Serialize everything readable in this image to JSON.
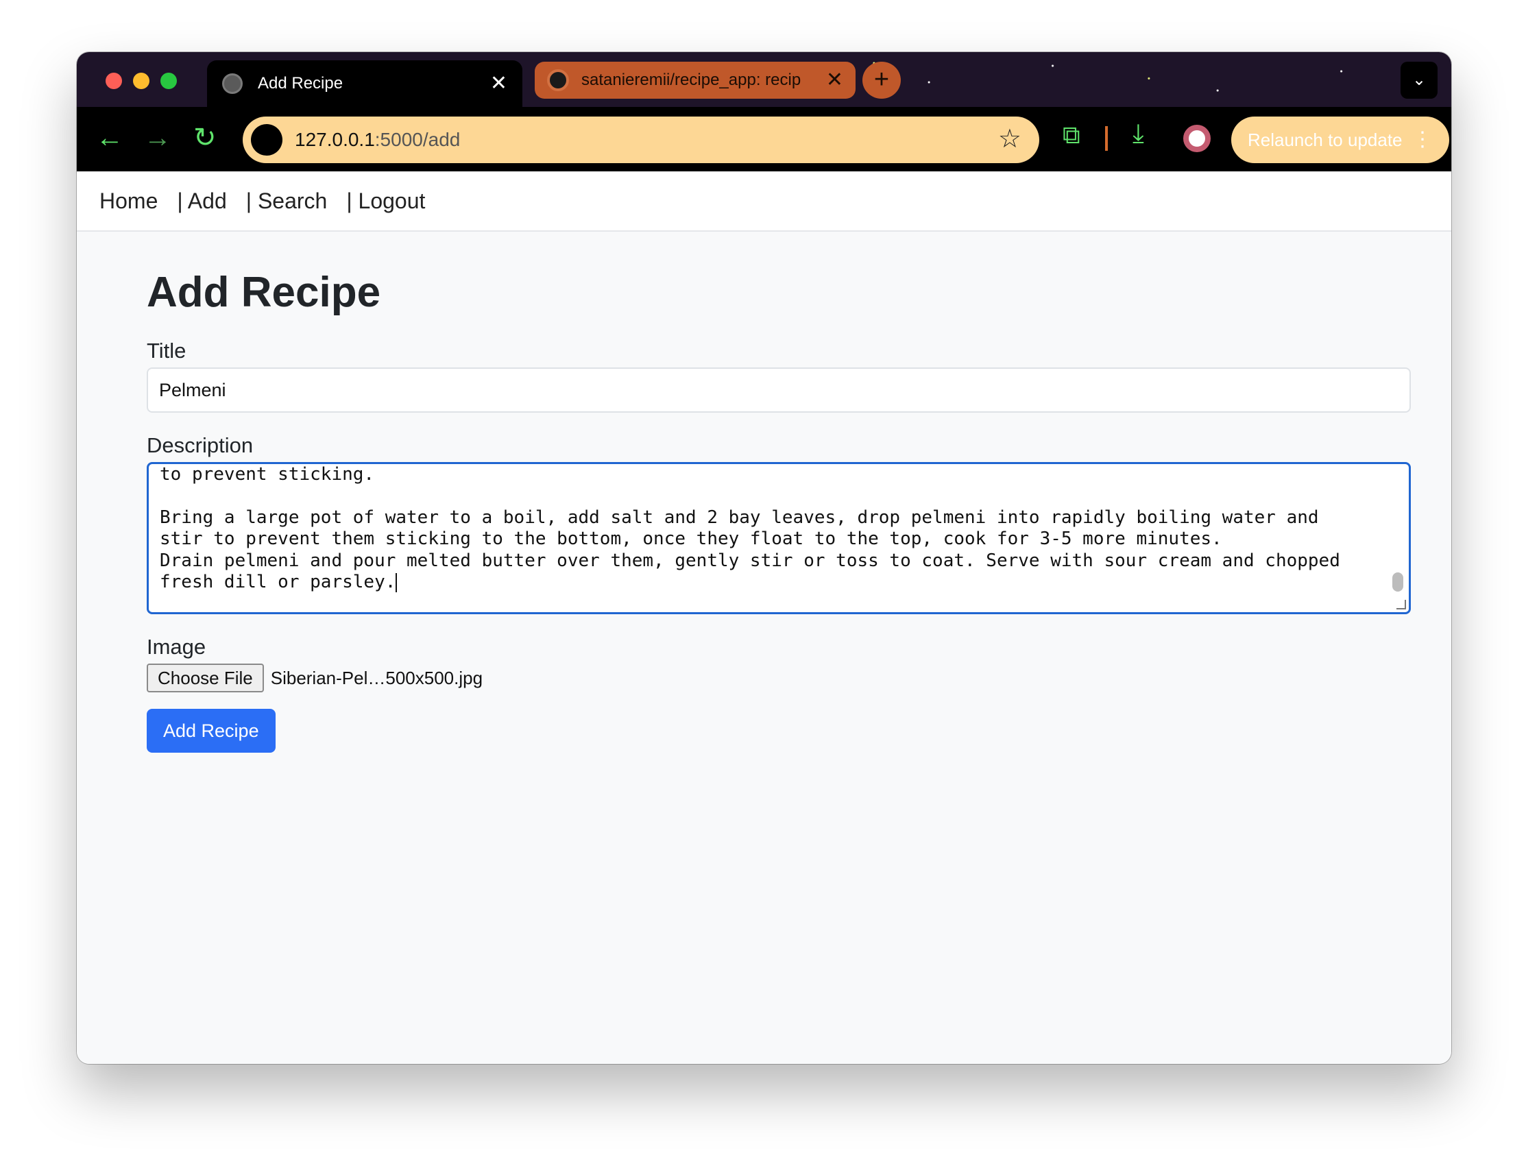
{
  "browser": {
    "tabs": [
      {
        "title": "Add Recipe",
        "icon": "globe-icon",
        "active": true
      },
      {
        "title": "satanieremii/recipe_app: recip",
        "icon": "github-icon",
        "active": false
      }
    ],
    "close_glyph": "✕",
    "new_tab_glyph": "+",
    "tab_menu_glyph": "⌄",
    "url_host": "127.0.0.1",
    "url_path": ":5000/add",
    "relaunch_label": "Relaunch to update",
    "relaunch_menu_glyph": "⋮",
    "colors": {
      "accent": "#5fe36b",
      "omnibox": "#fdd795",
      "tab_other": "#c0582a"
    }
  },
  "nav": {
    "home": "Home",
    "add": "| Add",
    "search": "| Search",
    "logout": "| Logout"
  },
  "form": {
    "heading": "Add Recipe",
    "title_label": "Title",
    "title_value": "Pelmeni",
    "description_label": "Description",
    "description_value": "Set aside a needed amount of pelmeni for dinner and freeze the rest in a well floured and air-tight container\nto prevent sticking.\n\nBring a large pot of water to a boil, add salt and 2 bay leaves, drop pelmeni into rapidly boiling water and\nstir to prevent them sticking to the bottom, once they float to the top, cook for 3-5 more minutes.\nDrain pelmeni and pour melted butter over them, gently stir or toss to coat. Serve with sour cream and chopped\nfresh dill or parsley.",
    "image_label": "Image",
    "choose_file_label": "Choose File",
    "file_name": "Siberian-Pel…500x500.jpg",
    "submit_label": "Add Recipe",
    "colors": {
      "primary": "#2b6ef5",
      "focus_border": "#2066d1"
    }
  }
}
